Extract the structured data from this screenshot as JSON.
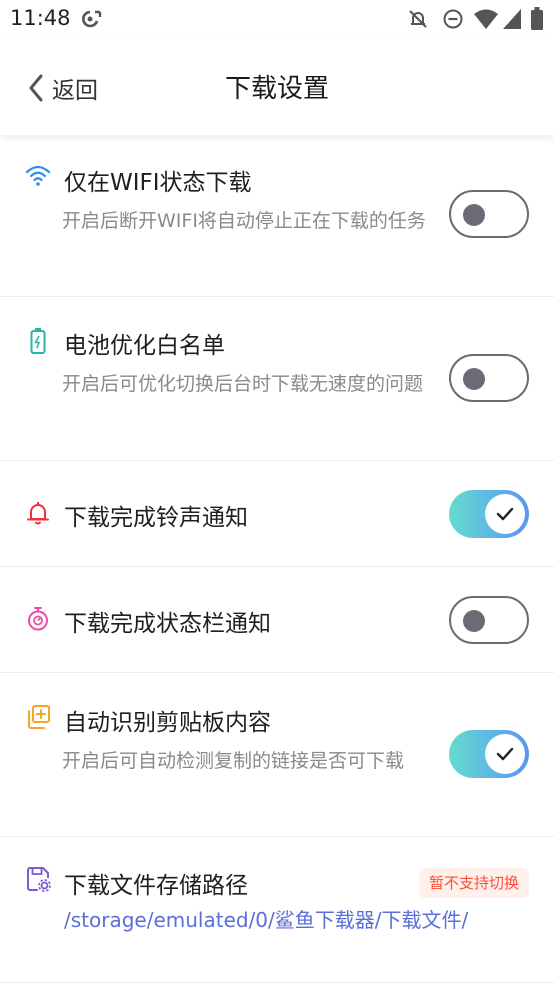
{
  "status_bar": {
    "time": "11:48",
    "icons": [
      "sync-icon",
      "alarm-off-icon",
      "do-not-disturb-icon",
      "wifi-icon",
      "signal-icon",
      "battery-icon"
    ]
  },
  "header": {
    "back_label": "返回",
    "title": "下载设置"
  },
  "settings": [
    {
      "icon": "wifi-icon",
      "icon_color": "#2a8ef0",
      "title": "仅在WIFI状态下载",
      "description": "开启后断开WIFI将自动停止正在下载的任务",
      "enabled": false
    },
    {
      "icon": "battery-icon",
      "icon_color": "#2ab3a6",
      "title": "电池优化白名单",
      "description": "开启后可优化切换后台时下载无速度的问题",
      "enabled": false
    },
    {
      "icon": "bell-icon",
      "icon_color": "#f0303c",
      "title": "下载完成铃声通知",
      "enabled": true
    },
    {
      "icon": "timer-icon",
      "icon_color": "#e94fa8",
      "title": "下载完成状态栏通知",
      "enabled": false
    },
    {
      "icon": "clipboard-add-icon",
      "icon_color": "#f5a623",
      "title": "自动识别剪贴板内容",
      "description": "开启后可自动检测复制的链接是否可下载",
      "enabled": true
    }
  ],
  "storage": {
    "icon": "storage-settings-icon",
    "icon_color": "#7a5cd6",
    "title": "下载文件存储路径",
    "badge": "暂不支持切换",
    "path": "/storage/emulated/0/鲨鱼下载器/下载文件/"
  },
  "colors": {
    "toggle_on_start": "#63dcd0",
    "toggle_on_end": "#5b95f1",
    "toggle_off": "#6d6a75",
    "path_text": "#5a6fd8",
    "badge_text": "#ff4b3a",
    "badge_bg": "#fff0ec"
  }
}
